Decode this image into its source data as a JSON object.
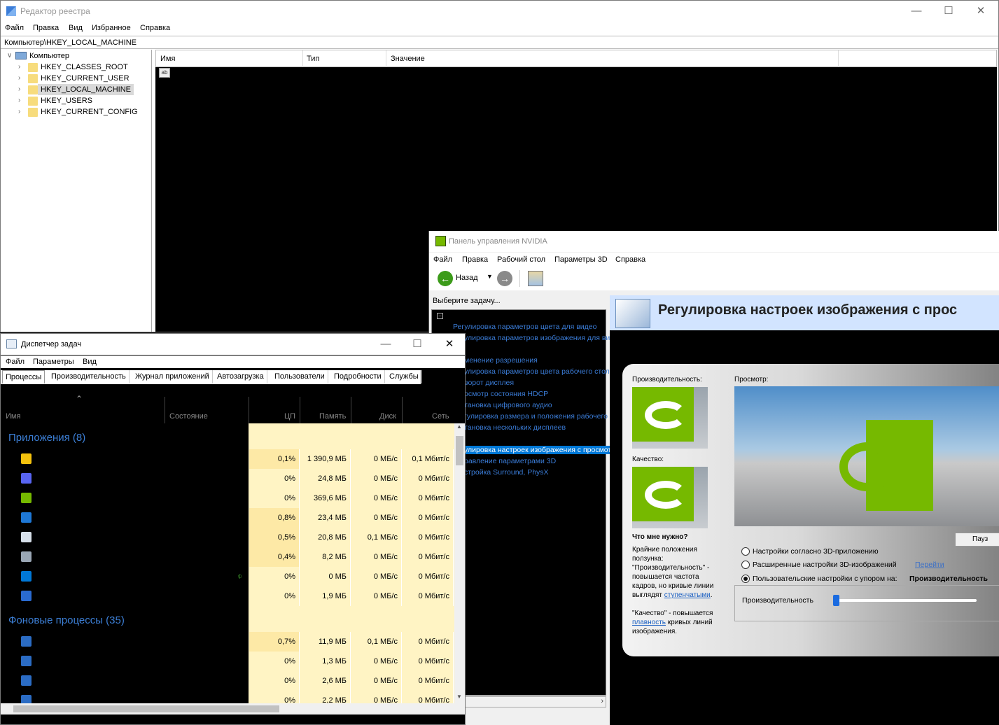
{
  "registry": {
    "title": "Редактор реестра",
    "menu": [
      "Файл",
      "Правка",
      "Вид",
      "Избранное",
      "Справка"
    ],
    "address": "Компьютер\\HKEY_LOCAL_MACHINE",
    "tree_root": "Компьютер",
    "tree_items": [
      "HKEY_CLASSES_ROOT",
      "HKEY_CURRENT_USER",
      "HKEY_LOCAL_MACHINE",
      "HKEY_USERS",
      "HKEY_CURRENT_CONFIG"
    ],
    "selected_index": 2,
    "columns": [
      "Имя",
      "Тип",
      "Значение"
    ],
    "value_icon_text": "ab"
  },
  "nvidia": {
    "title": "Панель управления NVIDIA",
    "menu": [
      "Файл",
      "Правка",
      "Рабочий стол",
      "Параметры 3D",
      "Справка"
    ],
    "back_label": "Назад",
    "task_label": "Выберите задачу...",
    "tasks": [
      "Регулировка параметров цвета для видео",
      "улировка параметров изображения для видео",
      "",
      "менение разрешения",
      "улировка параметров цвета рабочего стола",
      "ворот дисплея",
      "осмотр состояния HDCP",
      "тановка цифрового аудио",
      "гулировка размера и положения рабочего стола",
      "тановка нескольких дисплеев",
      "",
      "улировка настроек изображения с просмотром",
      "равление параметрами 3D",
      "стройка Surround, PhysX"
    ],
    "selected_task": 11,
    "page_title": "Регулировка настроек изображения с прос",
    "perf_label": "Производительность:",
    "quality_label": "Качество:",
    "preview_label": "Просмотр:",
    "help_heading": "Что мне нужно?",
    "help_p1": "Крайние положения ползунка: \"Производительность\" - повышается частота кадров, но кривые линии выглядят",
    "help_link1": "ступенчатыми",
    "help_p2": "\"Качество\" - повышается",
    "help_link2": "плавность",
    "help_p3": "кривых линий изображения.",
    "pause_label": "Пауз",
    "options": [
      "Настройки согласно 3D-приложению",
      "Расширенные настройки 3D-изображений",
      "Пользовательские настройки с упором на:"
    ],
    "option_link": "Перейти",
    "option_emphasis": "Производительность",
    "selected_option": 2,
    "slider_label": "Производительность",
    "slider_value": 0,
    "brand_green": "#76b900"
  },
  "taskmgr": {
    "title": "Диспетчер задач",
    "menu": [
      "Файл",
      "Параметры",
      "Вид"
    ],
    "tabs": [
      "Процессы",
      "Производительность",
      "Журнал приложений",
      "Автозагрузка",
      "Пользователи",
      "Подробности",
      "Службы"
    ],
    "active_tab": 0,
    "columns": {
      "name": "Имя",
      "state": "Состояние",
      "cpu": "ЦП",
      "mem": "Память",
      "disk": "Диск",
      "net": "Сеть"
    },
    "group_apps": "Приложения (8)",
    "group_bg": "Фоновые процессы (35)",
    "apps": [
      {
        "icon": "chrome-icon",
        "cpu": "0,1%",
        "mem": "1 390,9 МБ",
        "disk": "0 МБ/с",
        "net": "0,1 Мбит/с"
      },
      {
        "icon": "discord-icon",
        "cpu": "0%",
        "mem": "24,8 МБ",
        "disk": "0 МБ/с",
        "net": "0 Мбит/с"
      },
      {
        "icon": "nvidia-icon",
        "cpu": "0%",
        "mem": "369,6 МБ",
        "disk": "0 МБ/с",
        "net": "0 Мбит/с"
      },
      {
        "icon": "registry-icon",
        "cpu": "0,8%",
        "mem": "23,4 МБ",
        "disk": "0 МБ/с",
        "net": "0 Мбит/с"
      },
      {
        "icon": "taskmgr-icon",
        "cpu": "0,5%",
        "mem": "20,8 МБ",
        "disk": "0,1 МБ/с",
        "net": "0 Мбит/с"
      },
      {
        "icon": "explorer-icon",
        "cpu": "0,4%",
        "mem": "8,2 МБ",
        "disk": "0 МБ/с",
        "net": "0 Мбит/с"
      },
      {
        "icon": "settings-gear-icon",
        "cpu": "0%",
        "mem": "0 МБ",
        "disk": "0 МБ/с",
        "net": "0 Мбит/с"
      },
      {
        "icon": "store-icon",
        "cpu": "0%",
        "mem": "1,9 МБ",
        "disk": "0 МБ/с",
        "net": "0 Мбит/с"
      }
    ],
    "bg": [
      {
        "icon": "service-window-icon",
        "cpu": "0,7%",
        "mem": "11,9 МБ",
        "disk": "0,1 МБ/с",
        "net": "0 Мбит/с"
      },
      {
        "icon": "service-window-icon",
        "cpu": "0%",
        "mem": "1,3 МБ",
        "disk": "0 МБ/с",
        "net": "0 Мбит/с"
      },
      {
        "icon": "service-window-icon",
        "cpu": "0%",
        "mem": "2,6 МБ",
        "disk": "0 МБ/с",
        "net": "0 Мбит/с"
      },
      {
        "icon": "update-icon",
        "cpu": "0%",
        "mem": "2,2 МБ",
        "disk": "0 МБ/с",
        "net": "0 Мбит/с"
      }
    ]
  }
}
